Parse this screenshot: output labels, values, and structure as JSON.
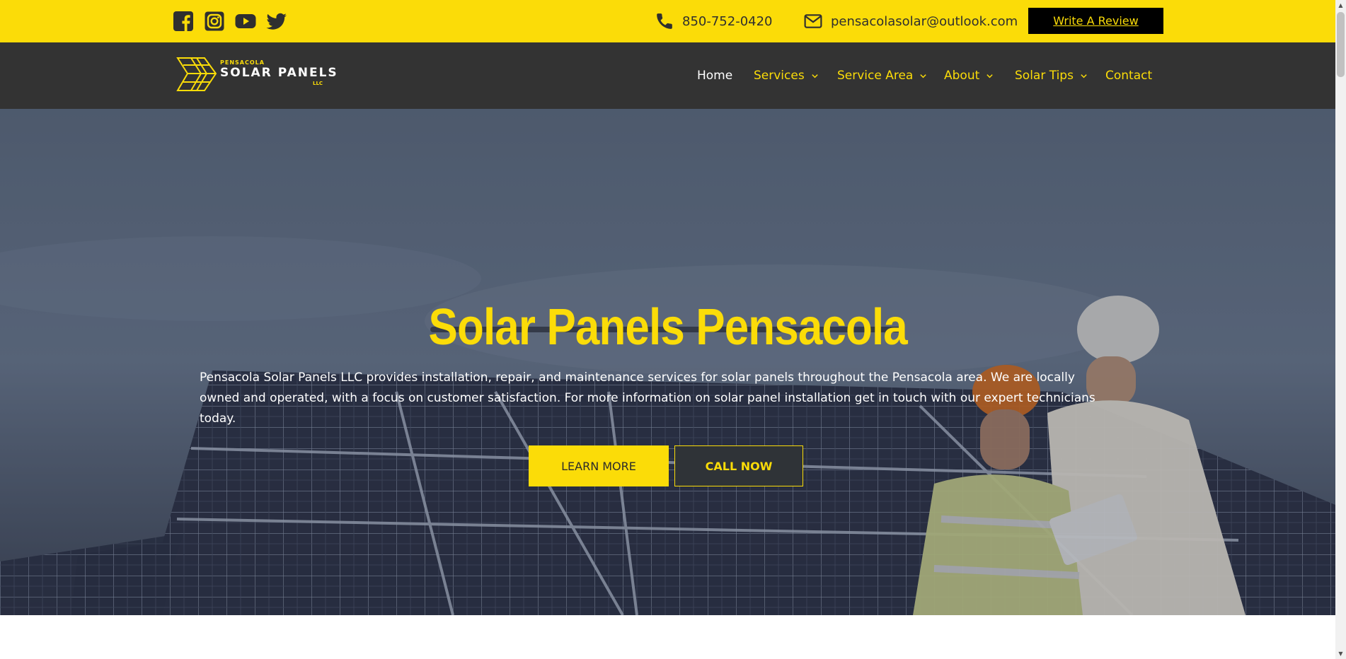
{
  "topbar": {
    "social": [
      {
        "name": "facebook-icon"
      },
      {
        "name": "instagram-icon"
      },
      {
        "name": "youtube-icon"
      },
      {
        "name": "twitter-icon"
      }
    ],
    "phone": "850-752-0420",
    "email": "pensacolasolar@outlook.com",
    "review_button": "Write A Review"
  },
  "logo": {
    "small": "PENSACOLA",
    "big": "SOLAR PANELS",
    "suffix": "LLC"
  },
  "nav": {
    "items": [
      {
        "label": "Home",
        "dropdown": false,
        "active": true
      },
      {
        "label": "Services",
        "dropdown": true
      },
      {
        "label": "Service Area",
        "dropdown": true
      },
      {
        "label": "About",
        "dropdown": true
      },
      {
        "label": "Solar Tips",
        "dropdown": true
      },
      {
        "label": "Contact",
        "dropdown": false
      }
    ]
  },
  "hero": {
    "title": "Solar Panels Pensacola",
    "text": "Pensacola Solar Panels LLC provides installation, repair, and maintenance services for solar panels throughout the Pensacola area. We are locally owned and operated, with a focus on customer satisfaction. For more information on solar panel installation get in touch with our expert technicians today.",
    "learn_more": "LEARN MORE",
    "call_now": "CALL NOW"
  },
  "colors": {
    "accent": "#fbdc08",
    "nav_bg": "#333333",
    "review_bg": "#000000"
  }
}
